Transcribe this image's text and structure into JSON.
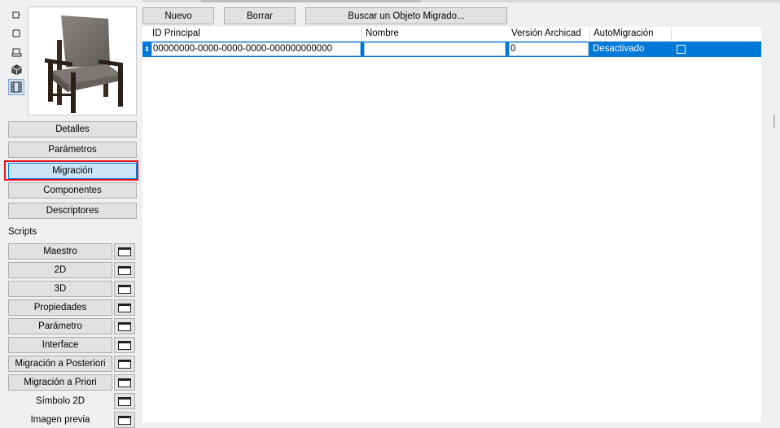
{
  "toolbar": {
    "new_label": "Nuevo",
    "delete_label": "Borrar",
    "find_label": "Buscar un Objeto Migrado..."
  },
  "side_view_icons": [
    "2d-symbol-icon",
    "3d-box-icon",
    "plan-view-icon",
    "3d-cube-icon",
    "preview-film-icon"
  ],
  "nav": {
    "details": "Detalles",
    "parameters": "Parámetros",
    "migration": "Migración",
    "components": "Componentes",
    "descriptors": "Descriptores"
  },
  "scripts": {
    "section_label": "Scripts",
    "items": [
      {
        "label": "Maestro"
      },
      {
        "label": "2D"
      },
      {
        "label": "3D"
      },
      {
        "label": "Propiedades"
      },
      {
        "label": "Parámetro"
      },
      {
        "label": "Interface"
      },
      {
        "label": "Migración a Posteriori"
      },
      {
        "label": "Migración a Priori"
      },
      {
        "label": "Símbolo 2D"
      },
      {
        "label": "Imagen previa"
      }
    ]
  },
  "table": {
    "headers": {
      "id": "ID Principal",
      "name": "Nombre",
      "version": "Versión Archicad",
      "auto": "AutoMigración"
    },
    "rows": [
      {
        "id": "00000000-0000-0000-0000-000000000000",
        "name": "",
        "version": "0",
        "auto": "Desactivado",
        "checked": false
      }
    ]
  },
  "colors": {
    "selection": "#0078d7",
    "highlight": "#e81123"
  }
}
